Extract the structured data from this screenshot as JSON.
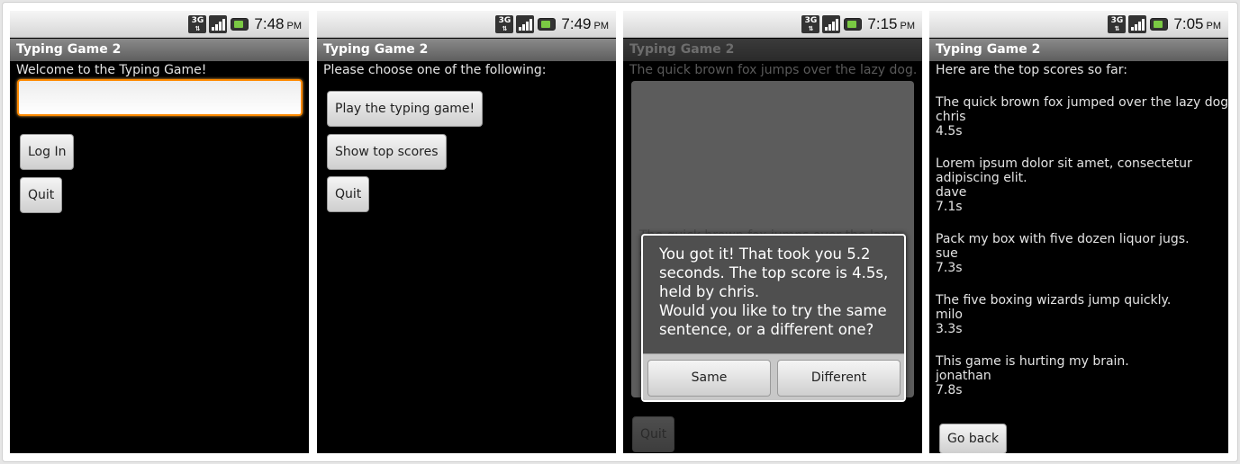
{
  "app_title": "Typing Game 2",
  "screens": [
    {
      "time": "7:48",
      "ampm": "PM",
      "label": "Welcome to the Typing Game!",
      "input_value": "",
      "buttons": {
        "login": "Log In",
        "quit": "Quit"
      }
    },
    {
      "time": "7:49",
      "ampm": "PM",
      "label": "Please choose one of the following:",
      "buttons": {
        "play": "Play the typing game!",
        "scores": "Show top scores",
        "quit": "Quit"
      }
    },
    {
      "time": "7:15",
      "ampm": "PM",
      "label": "The quick brown fox jumps over the lazy dog.",
      "ghost_text": "The quick brown fox jumps over the lazy dog.",
      "dialog": {
        "message_line1": "You got it! That took you 5.2 seconds. The top score is 4.5s, held by chris.",
        "message_line2": "Would you like to try the same sentence, or a different one?",
        "same": "Same",
        "different": "Different"
      },
      "buttons": {
        "quit": "Quit"
      }
    },
    {
      "time": "7:05",
      "ampm": "PM",
      "label": "Here are the top scores so far:",
      "scores": [
        {
          "sentence": "The quick brown fox jumped over the lazy dogs.",
          "user": "chris",
          "time": "4.5s"
        },
        {
          "sentence": "Lorem ipsum dolor sit amet, consectetur",
          "sentence2": "adipiscing elit.",
          "user": "dave",
          "time": "7.1s"
        },
        {
          "sentence": "Pack my box with five dozen liquor jugs.",
          "user": "sue",
          "time": "7.3s"
        },
        {
          "sentence": "The five boxing wizards jump quickly.",
          "user": "milo",
          "time": "3.3s"
        },
        {
          "sentence": "This game is hurting my brain.",
          "user": "jonathan",
          "time": "7.8s"
        }
      ],
      "buttons": {
        "go_back": "Go back"
      }
    }
  ],
  "status_icons": [
    "3g-icon",
    "signal-icon",
    "battery-icon"
  ],
  "colors": {
    "input_focus": "#ff8a00",
    "battery_green": "#7ac943",
    "screen_bg": "#000000"
  }
}
